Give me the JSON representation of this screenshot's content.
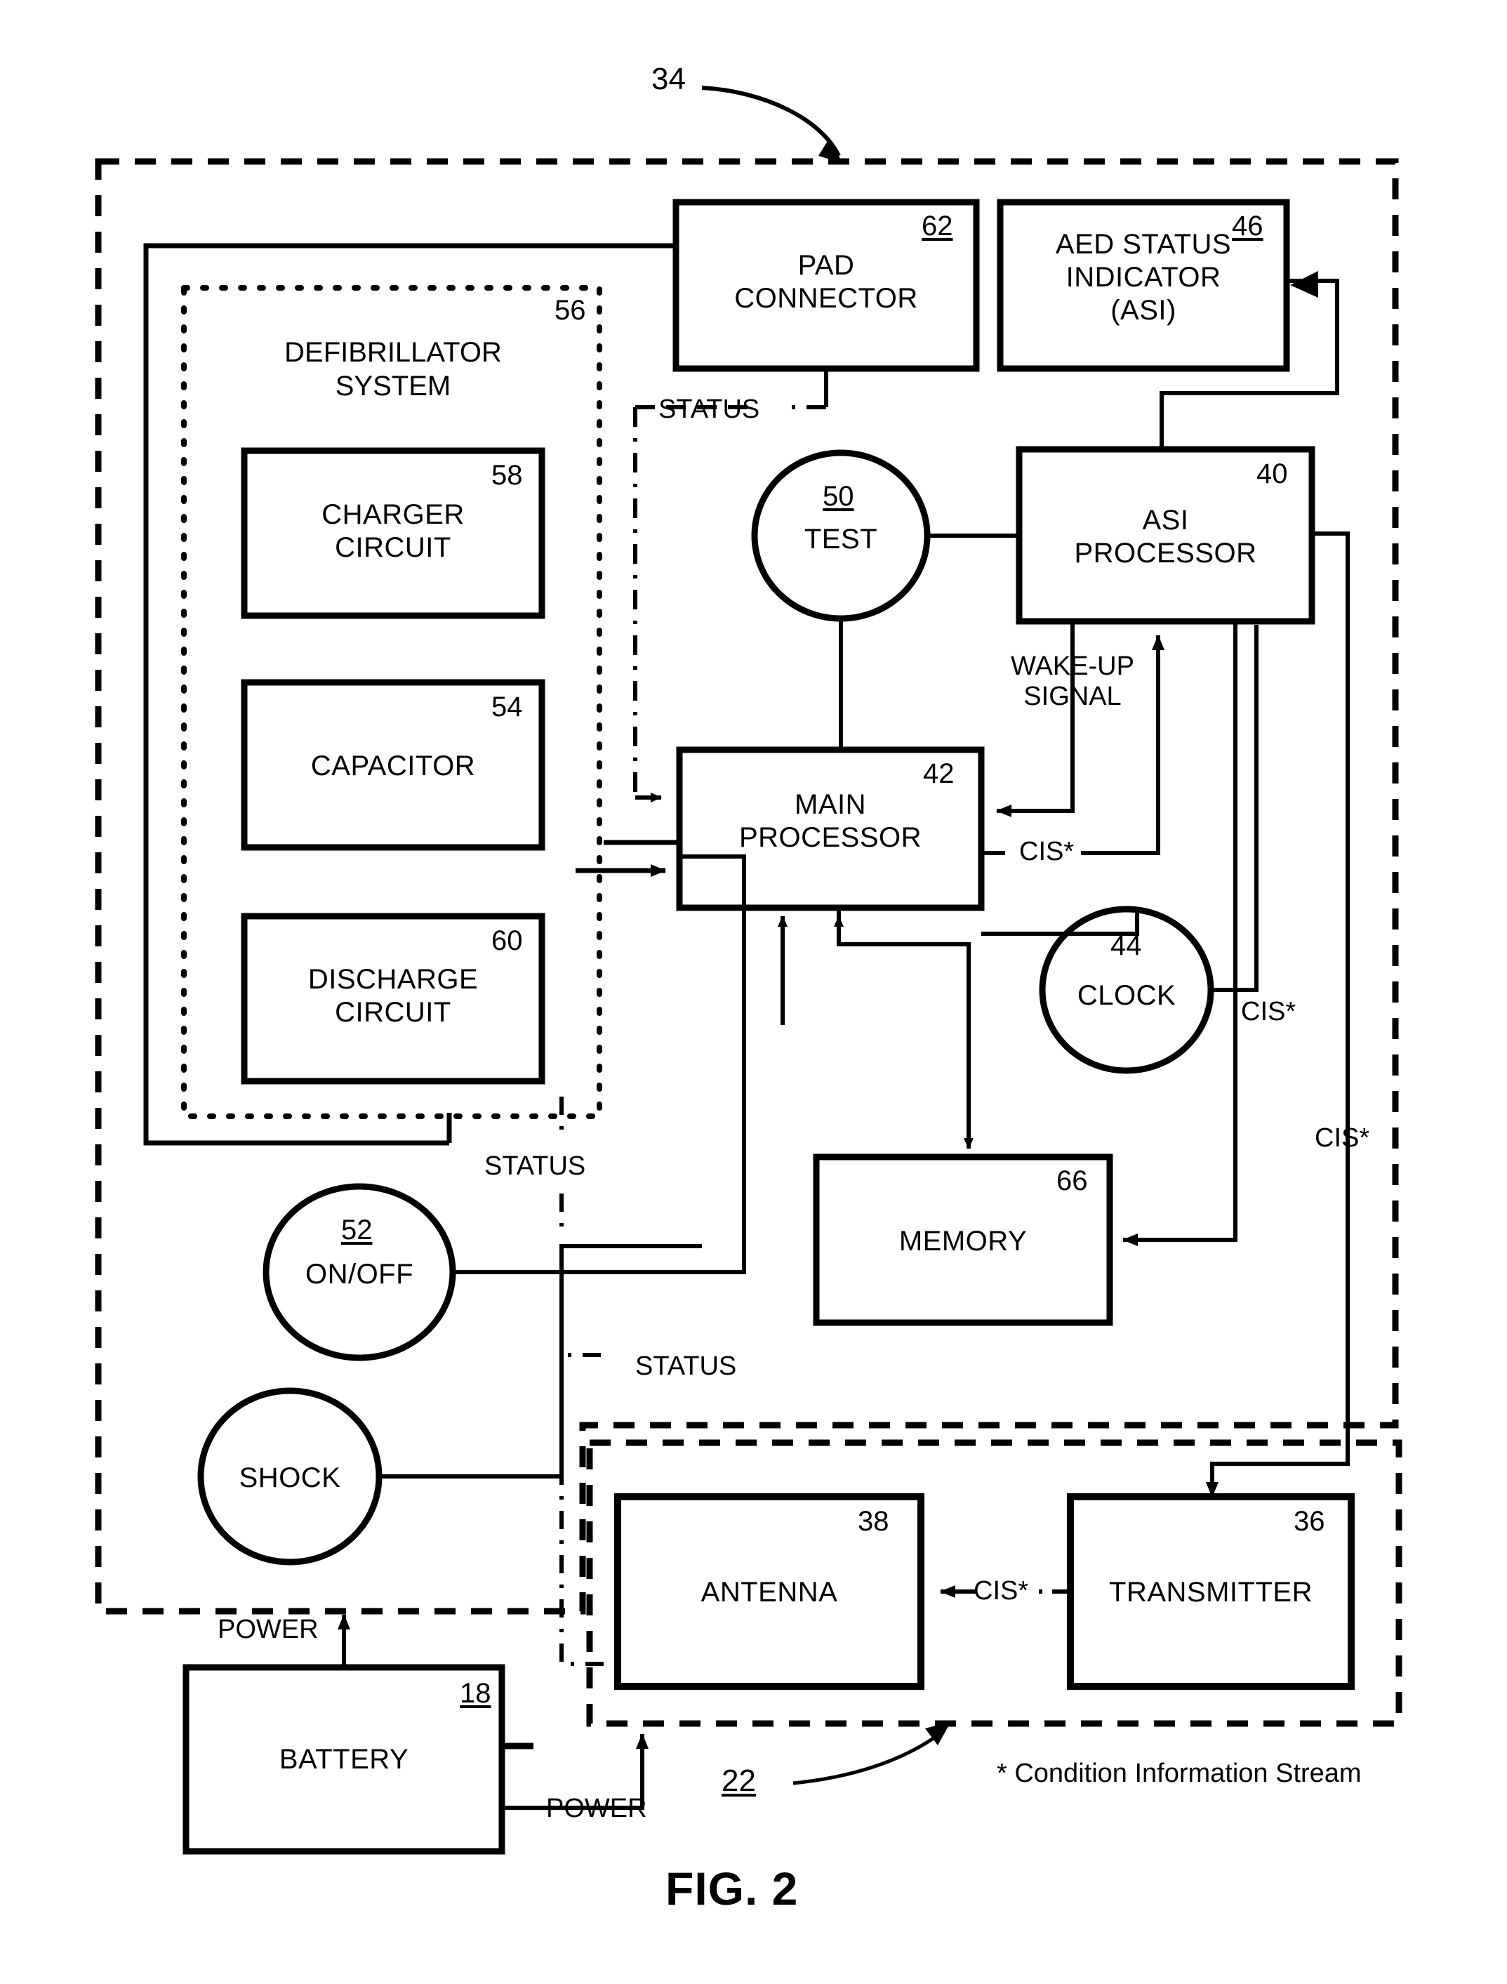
{
  "figure": {
    "caption": "FIG. 2",
    "system_ref": "34",
    "transmitter_group_ref": "22",
    "footnote": "* Condition Information Stream"
  },
  "groups": [
    {
      "name": "aed-system-boundary",
      "ref": "34",
      "style": "dashed"
    },
    {
      "name": "defibrillator-system",
      "ref": "56",
      "title": "DEFIBRILLATOR\nSYSTEM",
      "style": "dotted"
    },
    {
      "name": "communication-module-boundary",
      "ref": "22",
      "style": "dashed"
    }
  ],
  "blocks": [
    {
      "id": "pad-connector",
      "label": "PAD\nCONNECTOR",
      "ref": "62",
      "shape": "rect",
      "ref_underlined": true
    },
    {
      "id": "aed-status-indicator",
      "label": "AED STATUS\nINDICATOR\n(ASI)",
      "ref": "46",
      "shape": "rect",
      "ref_underlined": true
    },
    {
      "id": "charger-circuit",
      "label": "CHARGER\nCIRCUIT",
      "ref": "58",
      "shape": "rect",
      "ref_underlined": false
    },
    {
      "id": "capacitor",
      "label": "CAPACITOR",
      "ref": "54",
      "shape": "rect",
      "ref_underlined": false
    },
    {
      "id": "discharge-circuit",
      "label": "DISCHARGE\nCIRCUIT",
      "ref": "60",
      "shape": "rect",
      "ref_underlined": false
    },
    {
      "id": "test-button",
      "label": "TEST",
      "ref": "50",
      "shape": "circle",
      "ref_underlined": true
    },
    {
      "id": "asi-processor",
      "label": "ASI\nPROCESSOR",
      "ref": "40",
      "shape": "rect",
      "ref_underlined": false
    },
    {
      "id": "main-processor",
      "label": "MAIN\nPROCESSOR",
      "ref": "42",
      "shape": "rect",
      "ref_underlined": false
    },
    {
      "id": "clock",
      "label": "CLOCK",
      "ref": "44",
      "shape": "circle",
      "ref_underlined": false
    },
    {
      "id": "memory",
      "label": "MEMORY",
      "ref": "66",
      "shape": "rect",
      "ref_underlined": false
    },
    {
      "id": "on-off-button",
      "label": "ON/OFF",
      "ref": "52",
      "shape": "circle",
      "ref_underlined": true
    },
    {
      "id": "shock-button",
      "label": "SHOCK",
      "ref": "",
      "shape": "circle",
      "ref_underlined": false
    },
    {
      "id": "antenna",
      "label": "ANTENNA",
      "ref": "38",
      "shape": "rect",
      "ref_underlined": false
    },
    {
      "id": "transmitter",
      "label": "TRANSMITTER",
      "ref": "36",
      "shape": "rect",
      "ref_underlined": false
    },
    {
      "id": "battery",
      "label": "BATTERY",
      "ref": "18",
      "shape": "rect",
      "ref_underlined": true
    }
  ],
  "wire_labels": [
    {
      "id": "status-pad",
      "text": "STATUS"
    },
    {
      "id": "wake-up-signal",
      "text": "WAKE-UP\nSIGNAL"
    },
    {
      "id": "cis-main-to-asi",
      "text": "CIS*"
    },
    {
      "id": "cis-clock-right",
      "text": "CIS*"
    },
    {
      "id": "cis-far-right",
      "text": "CIS*"
    },
    {
      "id": "status-defib",
      "text": "STATUS"
    },
    {
      "id": "status-lower",
      "text": "STATUS"
    },
    {
      "id": "cis-transmitter",
      "text": "CIS*"
    },
    {
      "id": "power-upper",
      "text": "POWER"
    },
    {
      "id": "power-lower",
      "text": "POWER"
    }
  ],
  "colors": {
    "ink": "#000000",
    "paper": "#ffffff"
  }
}
